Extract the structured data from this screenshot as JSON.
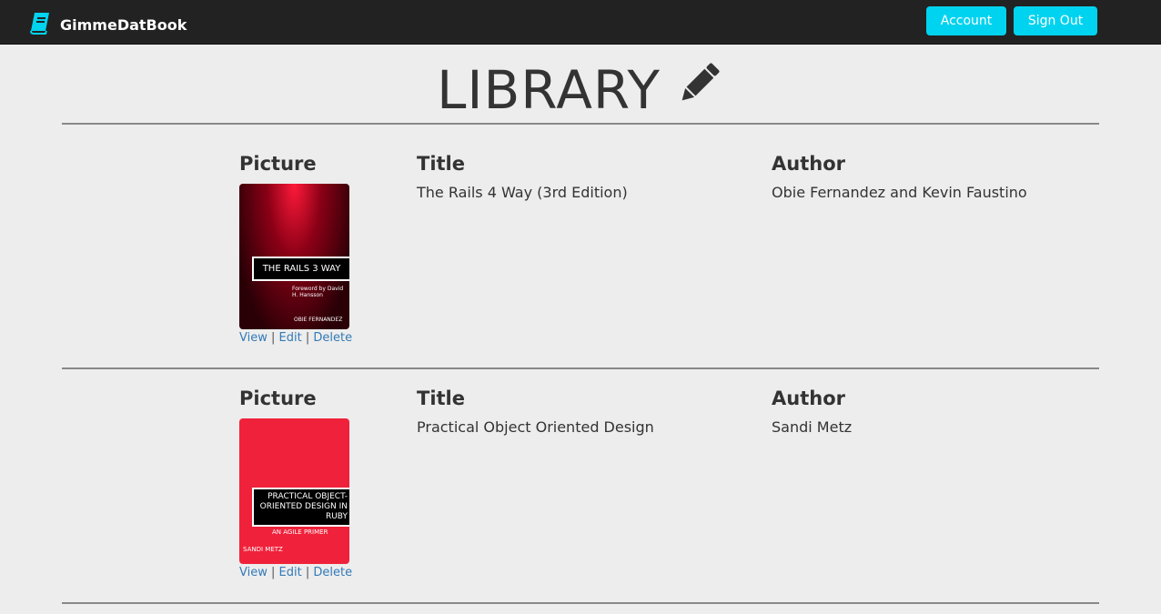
{
  "nav": {
    "brand": "GimmeDatBook",
    "account": "Account",
    "sign_out": "Sign Out",
    "accent": "#00d3ef"
  },
  "page": {
    "title": "LIBRARY"
  },
  "headers": {
    "picture": "Picture",
    "title": "Title",
    "author": "Author"
  },
  "links": {
    "view": "View",
    "edit": "Edit",
    "delete": "Delete",
    "sep": "|"
  },
  "books": [
    {
      "title": "The Rails 4 Way (3rd Edition)",
      "author": "Obie Fernandez and Kevin Faustino",
      "cover_title": "THE RAILS 3 WAY",
      "cover_author": "OBIE FERNANDEZ",
      "cover_foreword": "Foreword by David H. Hansson"
    },
    {
      "title": "Practical Object Oriented Design",
      "author": "Sandi Metz",
      "cover_title": "PRACTICAL OBJECT-ORIENTED DESIGN IN RUBY",
      "cover_subtitle": "AN AGILE PRIMER",
      "cover_author": "SANDI METZ"
    }
  ]
}
